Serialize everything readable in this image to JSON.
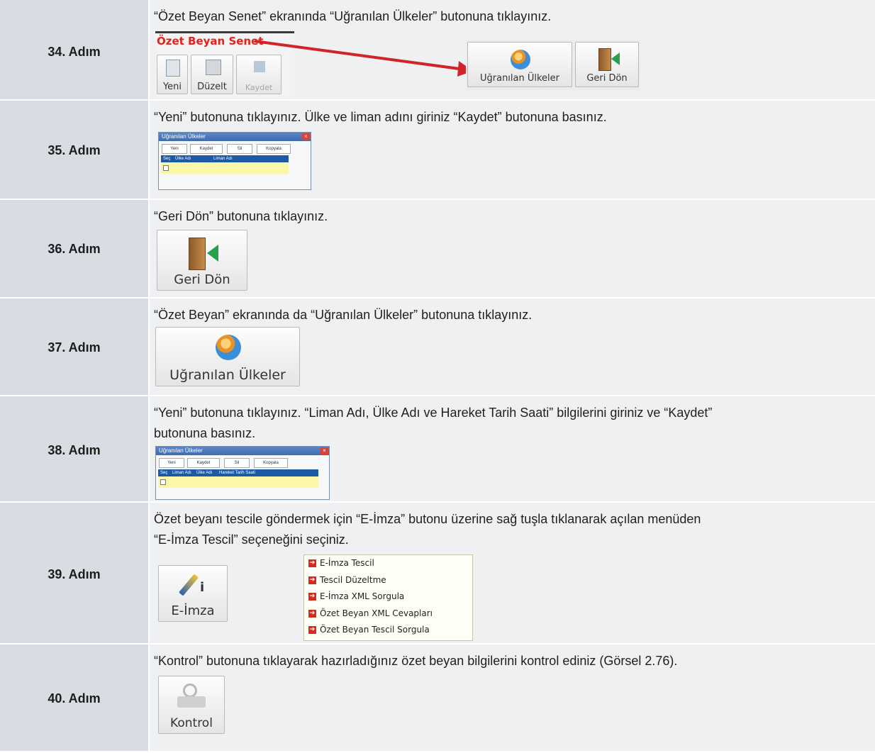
{
  "steps": [
    {
      "label": "34. Adım",
      "text": "“Özet Beyan Senet” ekranında “Uğranılan Ülkeler” butonuna tıklayınız."
    },
    {
      "label": "35. Adım",
      "text": "“Yeni” butonuna tıklayınız. Ülke ve liman adını giriniz “Kaydet” butonuna basınız."
    },
    {
      "label": "36. Adım",
      "text": "“Geri Dön” butonuna tıklayınız."
    },
    {
      "label": "37. Adım",
      "text": "“Özet Beyan” ekranında da “Uğranılan Ülkeler” butonuna tıklayınız."
    },
    {
      "label": "38. Adım",
      "text1": "“Yeni” butonuna tıklayınız. “Liman Adı, Ülke Adı ve Hareket Tarih Saati” bilgilerini giriniz ve “Kaydet”",
      "text2": "butonuna basınız."
    },
    {
      "label": "39. Adım",
      "text1": "Özet beyanı tescile göndermek için “E-İmza” butonu üzerine sağ tuşla tıklanarak açılan menüden",
      "text2": "“E-İmza Tescil” seçeneğini seçiniz."
    },
    {
      "label": "40. Adım",
      "text": "“Kontrol” butonuna tıklayarak hazırladığınız özet beyan bilgilerini kontrol ediniz (Görsel 2.76)."
    }
  ],
  "shot34": {
    "title": "Özet Beyan Senet",
    "buttons": [
      "Yeni",
      "Düzelt",
      "Kaydet"
    ],
    "target_buttons": [
      "Uğranılan Ülkeler",
      "Geri Dön"
    ]
  },
  "shot35": {
    "title": "Uğranılan Ülkeler",
    "toolbar": [
      "Yeni",
      "Kaydet",
      "Sil",
      "Kopyala"
    ],
    "columns": [
      "Seç",
      "Ülke Adı",
      "Liman Adı"
    ]
  },
  "shot36": {
    "button": "Geri Dön"
  },
  "shot37": {
    "button": "Uğranılan Ülkeler"
  },
  "shot38": {
    "title": "Uğranılan Ülkeler",
    "toolbar": [
      "Yeni",
      "Kaydet",
      "Sil",
      "Kopyala"
    ],
    "columns": [
      "Seç",
      "Liman Adı",
      "Ülke Adı",
      "Hareket Tarih Saati"
    ]
  },
  "shot39": {
    "button": "E-İmza",
    "menu": [
      "E-İmza Tescil",
      "Tescil Düzeltme",
      "E-İmza XML Sorgula",
      "Özet Beyan XML Cevapları",
      "Özet Beyan Tescil Sorgula"
    ]
  },
  "shot40": {
    "button": "Kontrol"
  },
  "colors": {
    "label_bg": "#d7dde3",
    "cell_bg": "#eff0f1",
    "arrow": "#d0232a",
    "title_red": "#e0231c"
  }
}
